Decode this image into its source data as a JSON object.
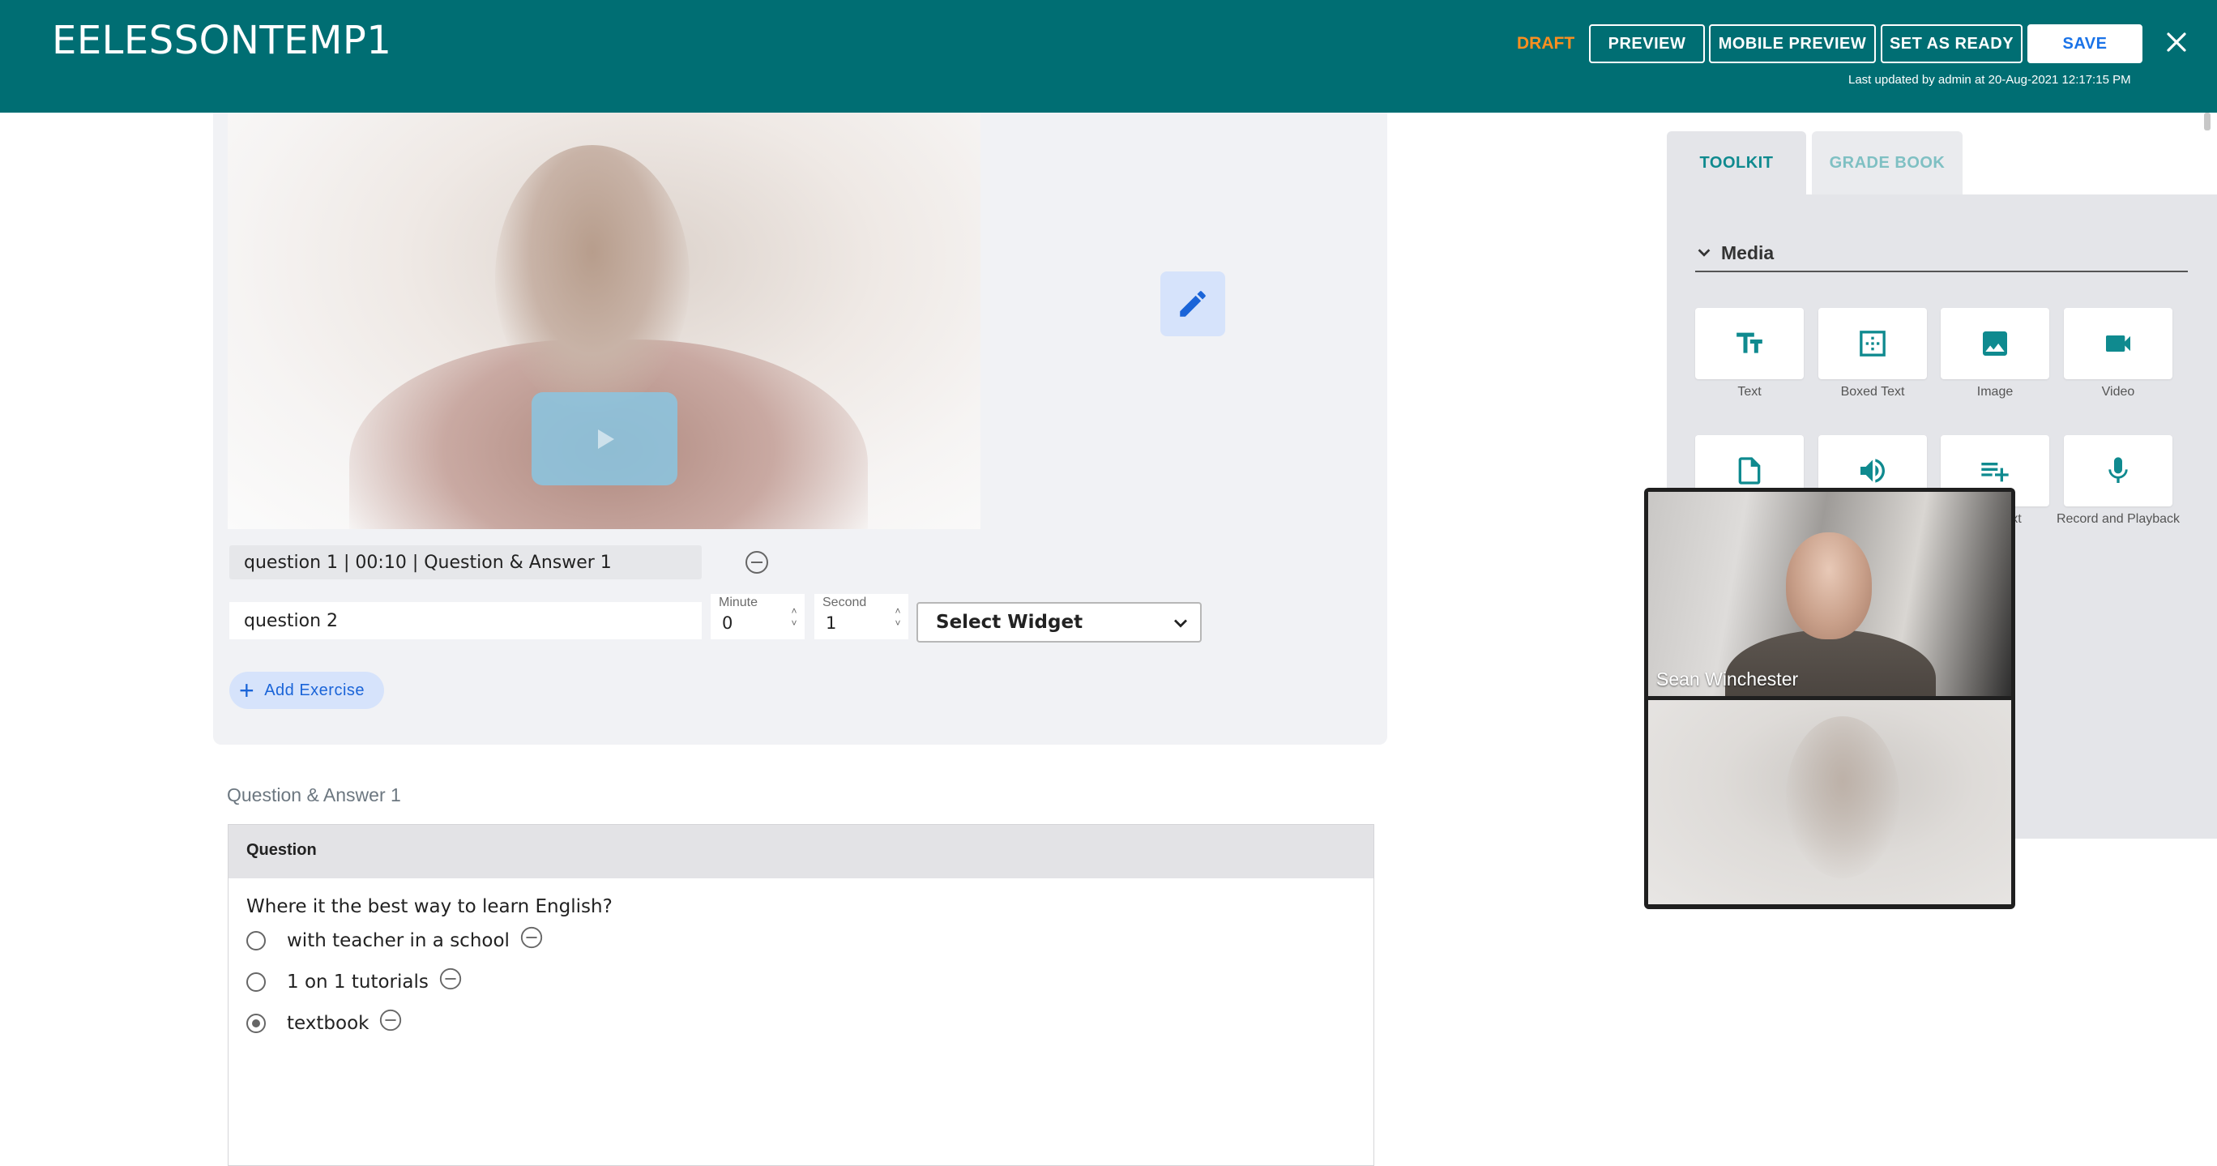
{
  "header": {
    "title": "EELESSONTEMP1",
    "status": "DRAFT",
    "buttons": {
      "preview": "PREVIEW",
      "mobile_preview": "MOBILE PREVIEW",
      "set_as_ready": "SET AS READY",
      "save": "SAVE"
    },
    "last_updated": "Last updated by admin at 20-Aug-2021 12:17:15 PM"
  },
  "exercise_editor": {
    "existing_exercise": "question 1 | 00:10 | Question & Answer 1",
    "new_exercise": {
      "name_value": "question 2",
      "minute_label": "Minute",
      "minute_value": "0",
      "second_label": "Second",
      "second_value": "1",
      "widget_select": "Select Widget"
    },
    "add_exercise_label": "Add Exercise"
  },
  "qa_section": {
    "heading": "Question & Answer 1",
    "card_title": "Question",
    "question": "Where it the best way to learn English?",
    "options": [
      {
        "label": "with teacher in a school",
        "selected": false
      },
      {
        "label": "1 on 1 tutorials",
        "selected": false
      },
      {
        "label": "textbook",
        "selected": true
      }
    ]
  },
  "toolkit": {
    "tabs": [
      "TOOLKIT",
      "GRADE BOOK"
    ],
    "active_tab": "TOOLKIT",
    "section_title": "Media",
    "tools": [
      {
        "label": "Text",
        "icon": "text-size-icon"
      },
      {
        "label": "Boxed Text",
        "icon": "boxed-text-icon"
      },
      {
        "label": "Image",
        "icon": "image-icon"
      },
      {
        "label": "Video",
        "icon": "video-camera-icon"
      },
      {
        "label": "",
        "icon": "document-icon"
      },
      {
        "label": "",
        "icon": "volume-icon"
      },
      {
        "label": "Text",
        "icon": "playlist-add-icon"
      },
      {
        "label": "Record and Playback",
        "icon": "microphone-icon"
      }
    ]
  },
  "video_call": {
    "participant_name": "Sean Winchester"
  },
  "colors": {
    "header_bg": "#006e73",
    "accent_teal": "#0f8a8f",
    "draft_orange": "#ff8f1f",
    "primary_blue": "#1a64d8"
  }
}
